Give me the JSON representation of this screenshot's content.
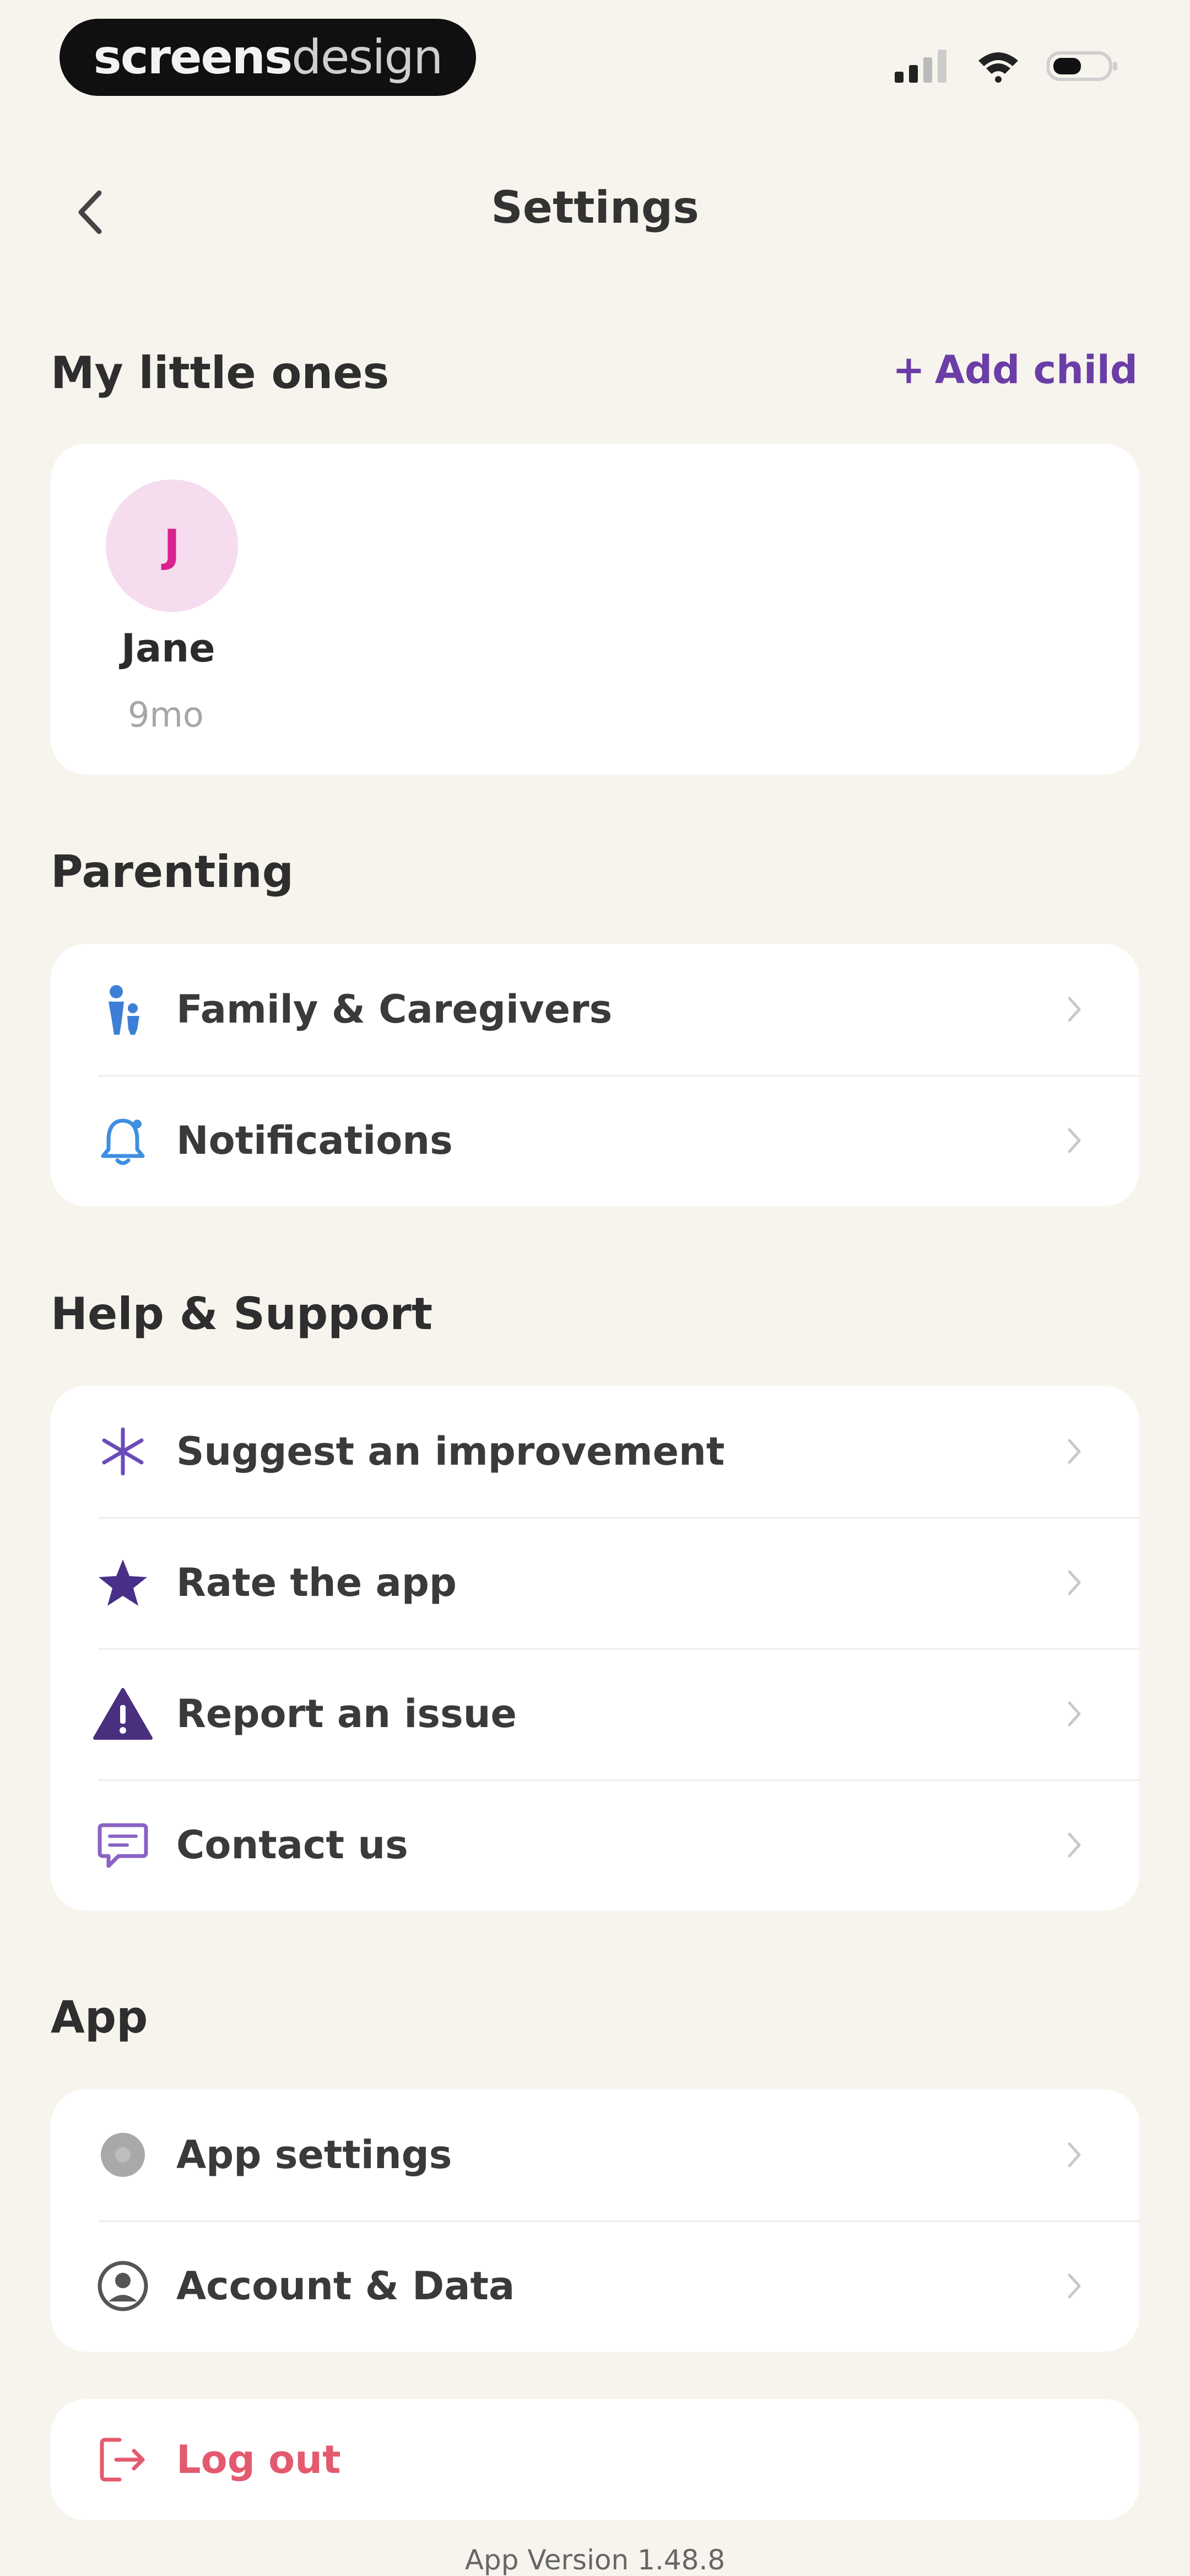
{
  "status_bar": {
    "brand_bold": "screens",
    "brand_light": "design"
  },
  "nav": {
    "title": "Settings"
  },
  "little_ones": {
    "header": "My little ones",
    "add_child_label": "Add child",
    "child": {
      "initial": "J",
      "name": "Jane",
      "age": "9mo"
    }
  },
  "parenting": {
    "header": "Parenting",
    "items": [
      {
        "label": "Family & Caregivers",
        "icon": "family-icon"
      },
      {
        "label": "Notifications",
        "icon": "bell-icon"
      }
    ]
  },
  "help": {
    "header": "Help & Support",
    "items": [
      {
        "label": "Suggest an improvement",
        "icon": "sparkle-icon"
      },
      {
        "label": "Rate the app",
        "icon": "star-icon"
      },
      {
        "label": "Report an issue",
        "icon": "warning-icon"
      },
      {
        "label": "Contact us",
        "icon": "chat-icon"
      }
    ]
  },
  "app": {
    "header": "App",
    "items": [
      {
        "label": "App settings",
        "icon": "gear-icon"
      },
      {
        "label": "Account & Data",
        "icon": "account-icon"
      }
    ]
  },
  "logout": {
    "label": "Log out",
    "icon": "logout-icon"
  },
  "footer": {
    "version": "App Version 1.48.8"
  },
  "colors": {
    "background": "#f7f4ee",
    "accent_purple": "#6a3ea6",
    "avatar_pink": "#f5dcef",
    "logout_red": "#e35a6e"
  }
}
